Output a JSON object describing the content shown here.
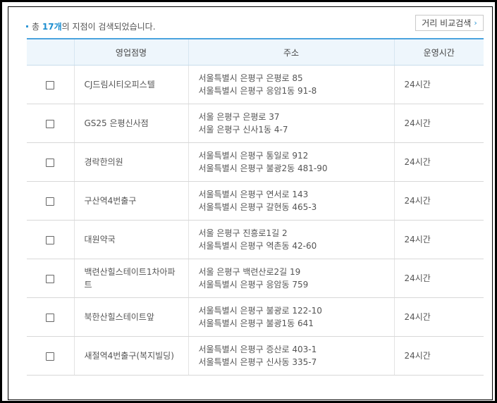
{
  "summary": {
    "prefix": "총",
    "count": "17개",
    "suffix": "의 지점이 검색되었습니다."
  },
  "compare_button": {
    "label": "거리 비교검색",
    "icon": "chevron-right-icon",
    "icon_glyph": "›"
  },
  "table": {
    "columns": [
      "",
      "영업점명",
      "주소",
      "운영시간"
    ],
    "rows": [
      {
        "name": "CJ드림시티오피스텔",
        "address_road": "서울특별시 은평구 은평로 85",
        "address_lot": "서울특별시 은평구 응암1동 91-8",
        "hours": "24시간"
      },
      {
        "name": "GS25 은평신사점",
        "address_road": "서울 은평구 은평로 37",
        "address_lot": "서울 은평구 신사1동 4-7",
        "hours": "24시간"
      },
      {
        "name": "경락한의원",
        "address_road": "서울특별시 은평구 통일로 912",
        "address_lot": "서울특별시 은평구 불광2동 481-90",
        "hours": "24시간"
      },
      {
        "name": "구산역4번출구",
        "address_road": "서울특별시 은평구 연서로 143",
        "address_lot": "서울특별시 은평구 갈현동 465-3",
        "hours": "24시간"
      },
      {
        "name": "대원약국",
        "address_road": "서울 은평구 진흥로1길 2",
        "address_lot": "서울특별시 은평구 역촌동 42-60",
        "hours": "24시간"
      },
      {
        "name": "백련산힐스테이트1차아파트",
        "address_road": "서울 은평구 백련산로2길 19",
        "address_lot": "서울특별시 은평구 응암동 759",
        "hours": "24시간"
      },
      {
        "name": "북한산힐스테이트앞",
        "address_road": "서울특별시 은평구 불광로 122-10",
        "address_lot": "서울특별시 은평구 불광1동 641",
        "hours": "24시간"
      },
      {
        "name": "새절역4번출구(복지빌딩)",
        "address_road": "서울특별시 은평구 증산로 403-1",
        "address_lot": "서울특별시 은평구 신사동 335-7",
        "hours": "24시간"
      }
    ]
  },
  "colors": {
    "accent": "#2f97d6",
    "header_bg": "#eef6fc",
    "header_top_border": "#4aa3de"
  }
}
